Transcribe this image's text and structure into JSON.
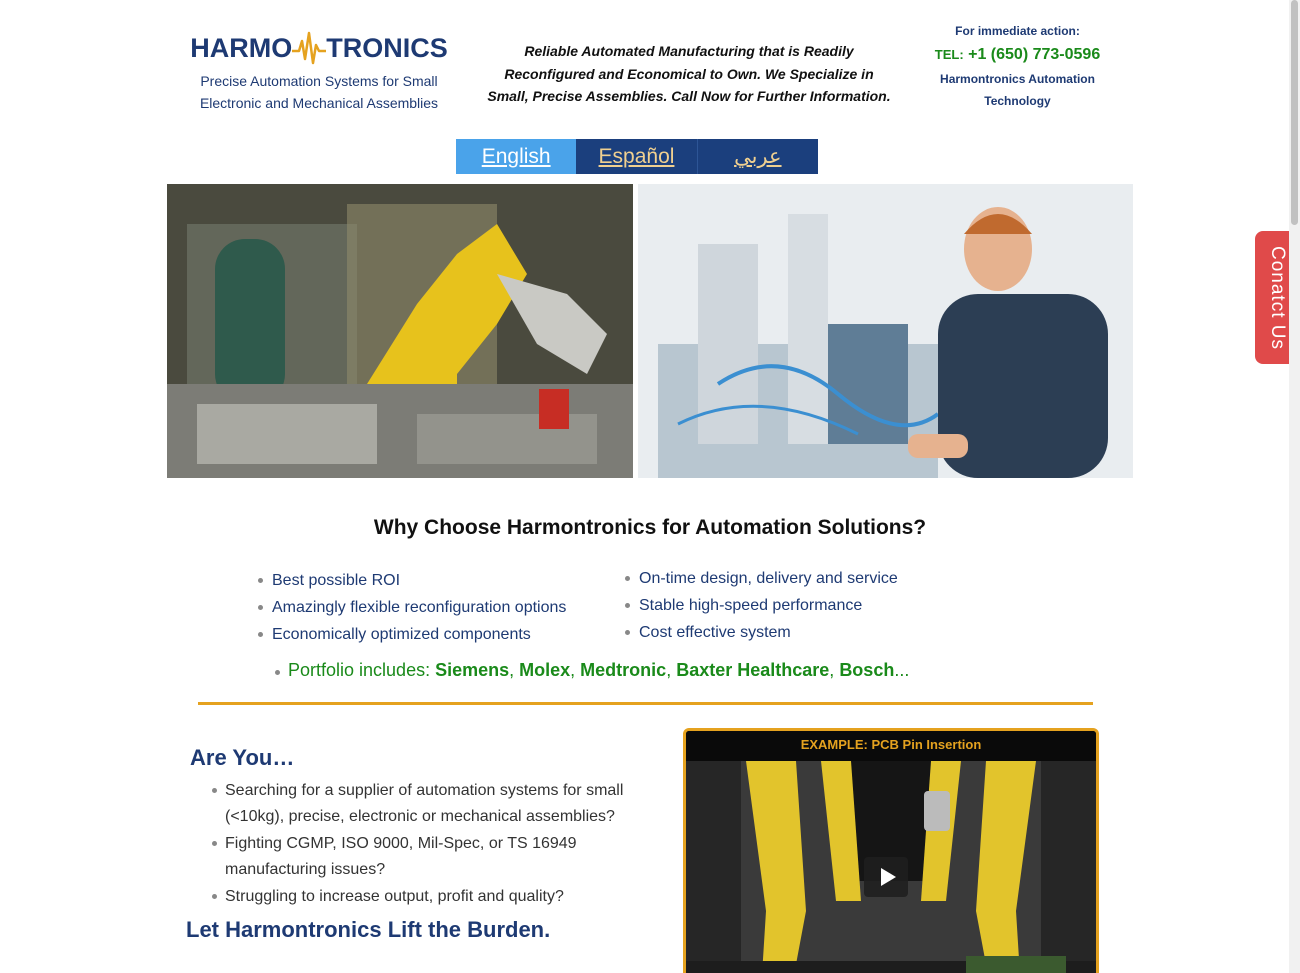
{
  "header": {
    "logo_text_left": "HARMO",
    "logo_text_right": "TRONICS",
    "logo_tagline_1": "Precise Automation Systems for Small",
    "logo_tagline_2": "Electronic and Mechanical Assemblies",
    "slogan_1": "Reliable Automated Manufacturing that is Readily",
    "slogan_2": "Reconfigured and Economical to Own. We Specialize in",
    "slogan_3": "Small, Precise Assemblies.  Call Now for Further Information.",
    "contact_lead": "For immediate action:",
    "tel_label": "TEL:",
    "tel_number": "+1 (650) 773-0596",
    "company_1": "Harmontronics Automation",
    "company_2": "Technology"
  },
  "languages": [
    {
      "label": "English"
    },
    {
      "label": "Español"
    },
    {
      "label": "عربي"
    }
  ],
  "why": {
    "title": "Why Choose Harmontronics for Automation Solutions?",
    "left_items": [
      "Best possible ROI",
      "Amazingly flexible reconfiguration options",
      "Economically optimized components"
    ],
    "right_items": [
      "On-time design, delivery and service",
      "Stable high-speed performance",
      "Cost effective system"
    ],
    "portfolio_prefix": "Portfolio includes: ",
    "portfolio_clients": [
      "Siemens",
      "Molex",
      "Medtronic",
      "Baxter Healthcare",
      "Bosch"
    ],
    "portfolio_sep": ", ",
    "portfolio_suffix": "..."
  },
  "are_you": {
    "title": "Are You…",
    "items": [
      "Searching for a supplier of automation systems for small (<10kg), precise, electronic or mechanical assemblies?",
      "Fighting CGMP, ISO 9000, Mil-Spec, or TS 16949 manufacturing issues?",
      "Struggling to increase output, profit and quality?"
    ],
    "cta": "Let Harmontronics Lift the Burden."
  },
  "video": {
    "title": "EXAMPLE: PCB Pin Insertion"
  },
  "contact_tab": {
    "label": "Conatct Us"
  },
  "colors": {
    "brand_navy": "#1e3a73",
    "accent_gold": "#e5a21f",
    "green": "#1a8a1a",
    "lang_active": "#4aa3ea",
    "lang_inactive": "#1b3f7d",
    "contact_red": "#e04a4a"
  }
}
